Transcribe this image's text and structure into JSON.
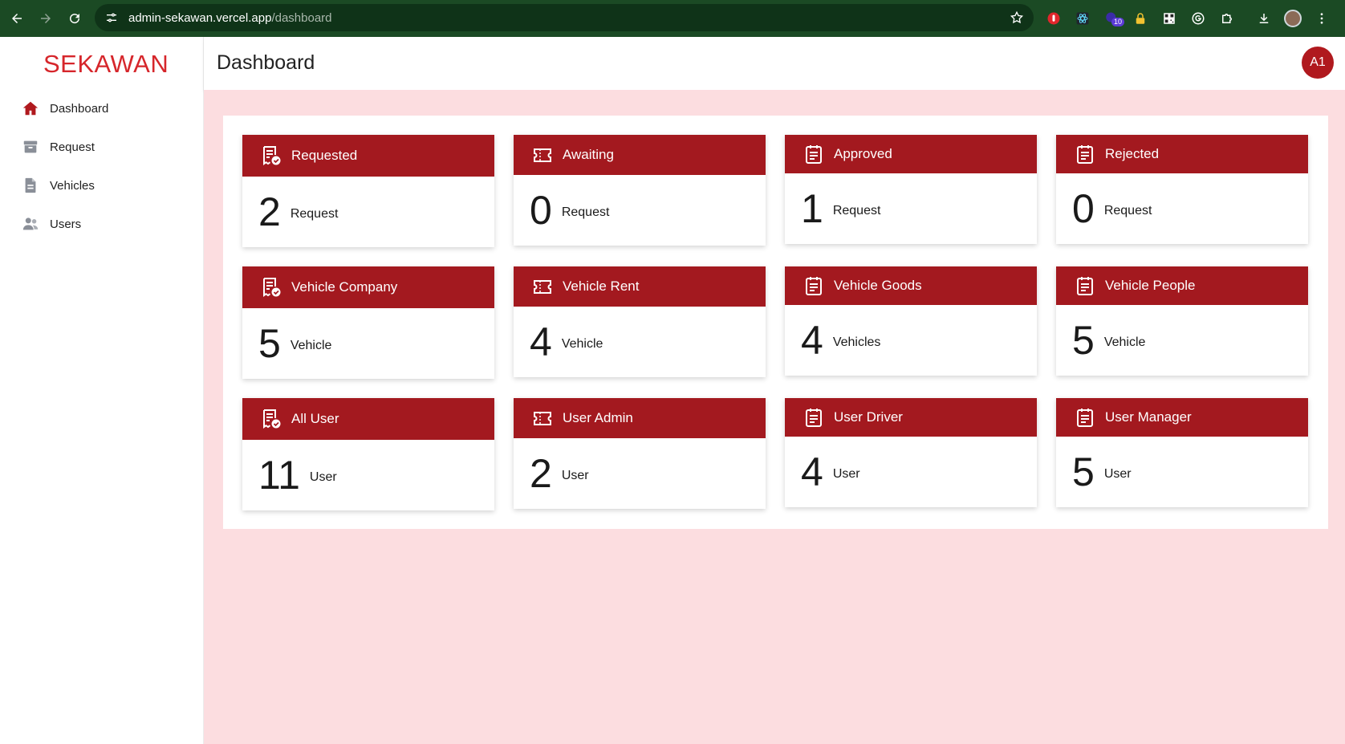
{
  "browser": {
    "url_host": "admin-sekawan.vercel.app",
    "url_path": "/dashboard",
    "extension_badge": "10"
  },
  "sidebar": {
    "brand": "SEKAWAN",
    "items": [
      {
        "label": "Dashboard",
        "icon": "home-icon",
        "active": true
      },
      {
        "label": "Request",
        "icon": "archive-icon"
      },
      {
        "label": "Vehicles",
        "icon": "document-icon"
      },
      {
        "label": "Users",
        "icon": "users-icon"
      }
    ]
  },
  "header": {
    "title": "Dashboard",
    "avatar": "A1"
  },
  "colors": {
    "accent": "#a3191f",
    "brand": "#d6262b",
    "background": "#fcdde0"
  },
  "cards": [
    {
      "title": "Requested",
      "count": "2",
      "unit": "Request",
      "icon": "receipt-check-icon"
    },
    {
      "title": "Awaiting",
      "count": "0",
      "unit": "Request",
      "icon": "ticket-icon"
    },
    {
      "title": "Approved",
      "count": "1",
      "unit": "Request",
      "icon": "clipboard-icon"
    },
    {
      "title": "Rejected",
      "count": "0",
      "unit": "Request",
      "icon": "clipboard-icon"
    },
    {
      "title": "Vehicle Company",
      "count": "5",
      "unit": "Vehicle",
      "icon": "receipt-check-icon"
    },
    {
      "title": "Vehicle Rent",
      "count": "4",
      "unit": "Vehicle",
      "icon": "ticket-icon"
    },
    {
      "title": "Vehicle Goods",
      "count": "4",
      "unit": "Vehicles",
      "icon": "clipboard-icon"
    },
    {
      "title": "Vehicle People",
      "count": "5",
      "unit": "Vehicle",
      "icon": "clipboard-icon"
    },
    {
      "title": "All User",
      "count": "11",
      "unit": "User",
      "icon": "receipt-check-icon"
    },
    {
      "title": "User Admin",
      "count": "2",
      "unit": "User",
      "icon": "ticket-icon"
    },
    {
      "title": "User Driver",
      "count": "4",
      "unit": "User",
      "icon": "clipboard-icon"
    },
    {
      "title": "User Manager",
      "count": "5",
      "unit": "User",
      "icon": "clipboard-icon"
    }
  ]
}
